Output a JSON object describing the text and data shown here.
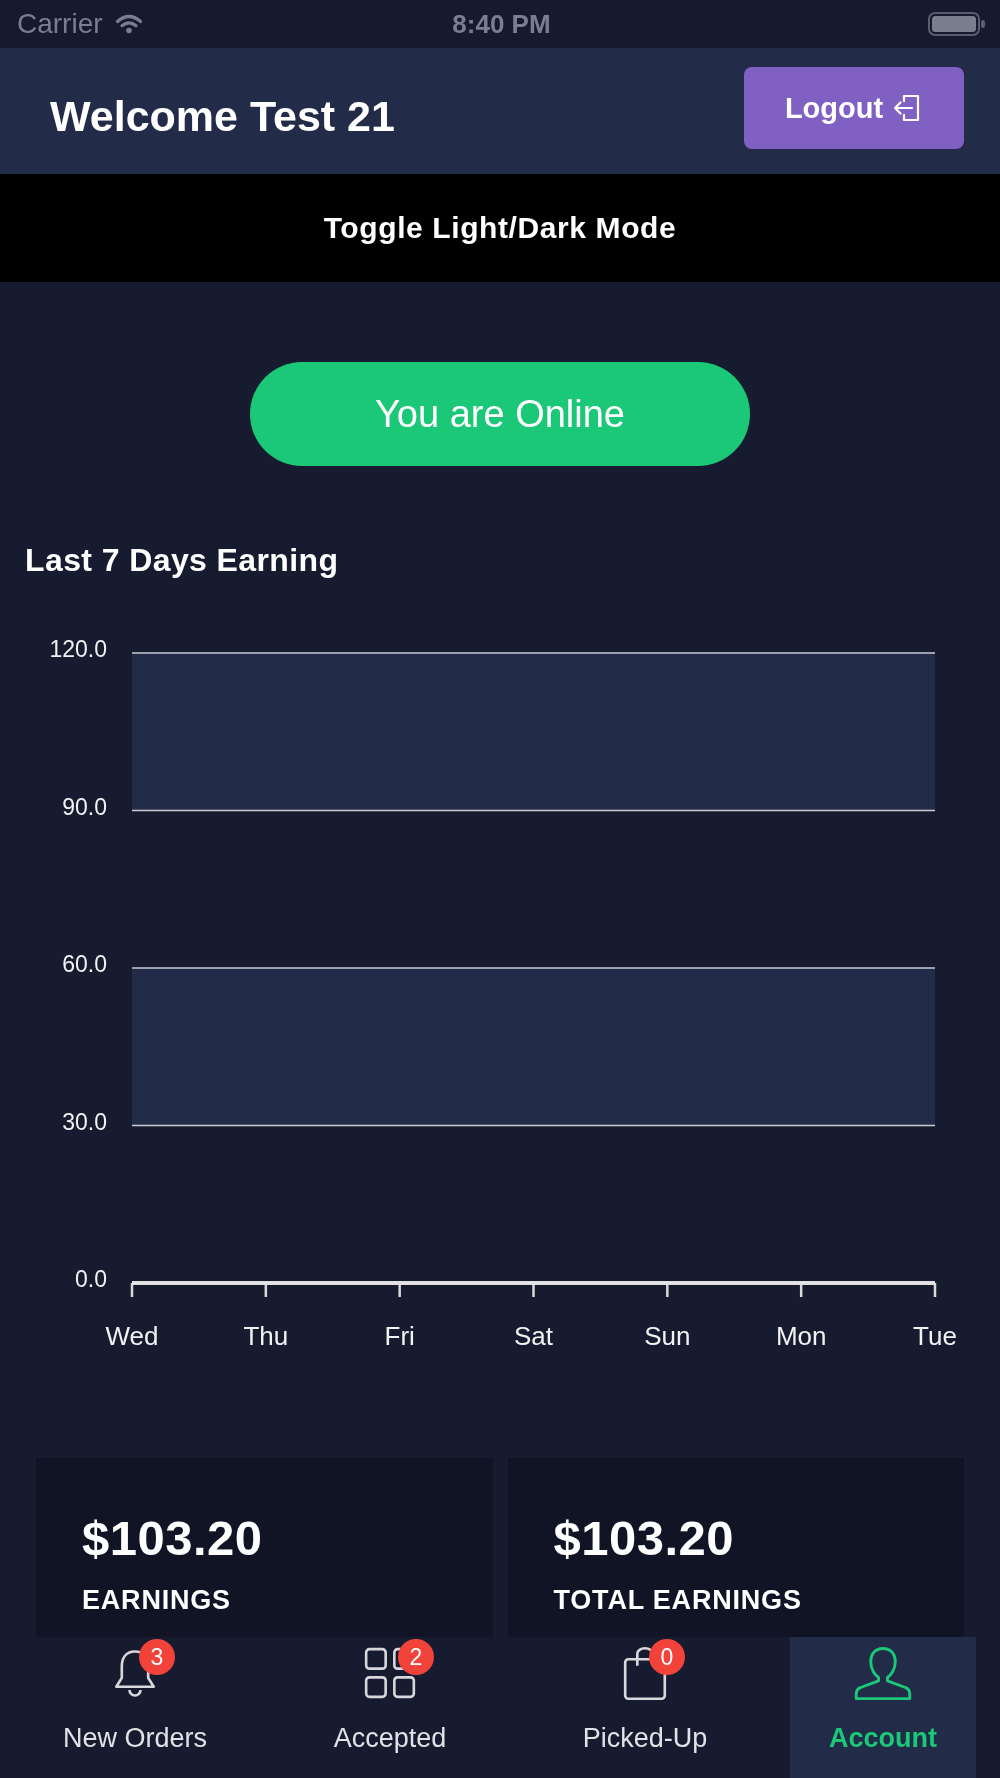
{
  "status_bar": {
    "carrier": "Carrier",
    "time": "8:40 PM"
  },
  "header": {
    "title": "Welcome Test 21",
    "logout_button": {
      "label": "Logout"
    }
  },
  "theme_toggle": {
    "label": "Toggle Light/Dark Mode"
  },
  "status_button": {
    "label": "You are Online",
    "online": true
  },
  "earnings_chart": {
    "chart_data": {
      "type": "line",
      "title": "Last 7 Days Earning",
      "categories": [
        "Wed",
        "Thu",
        "Fri",
        "Sat",
        "Sun",
        "Mon",
        "Tue"
      ],
      "values": [
        0,
        0,
        0,
        0,
        0,
        0,
        0
      ],
      "ylim": [
        0,
        120
      ],
      "yticks": [
        {
          "value": 0,
          "label": "0.0"
        },
        {
          "value": 30,
          "label": "30.0"
        },
        {
          "value": 60,
          "label": "60.0"
        },
        {
          "value": 90,
          "label": "90.0"
        },
        {
          "value": 120,
          "label": "120.0"
        }
      ],
      "grid": true
    }
  },
  "stat_cards": [
    {
      "amount": "$103.20",
      "label": "EARNINGS"
    },
    {
      "amount": "$103.20",
      "label": "TOTAL EARNINGS"
    }
  ],
  "tab_bar": [
    {
      "label": "New Orders",
      "badge": "3",
      "selected": false
    },
    {
      "label": "Accepted",
      "badge": "2",
      "selected": false
    },
    {
      "label": "Picked-Up",
      "badge": "0",
      "selected": false
    },
    {
      "label": "Account",
      "selected": true
    }
  ]
}
